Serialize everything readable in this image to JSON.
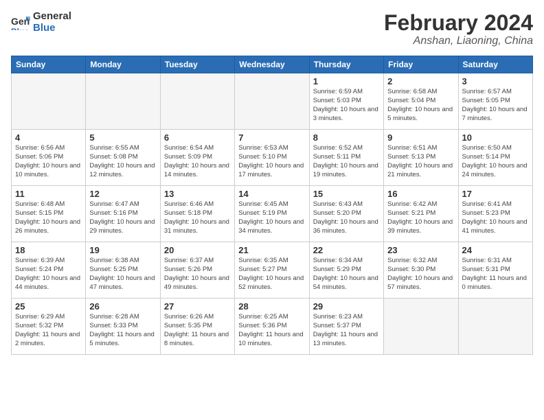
{
  "header": {
    "logo_line1": "General",
    "logo_line2": "Blue",
    "main_title": "February 2024",
    "subtitle": "Anshan, Liaoning, China"
  },
  "weekdays": [
    "Sunday",
    "Monday",
    "Tuesday",
    "Wednesday",
    "Thursday",
    "Friday",
    "Saturday"
  ],
  "weeks": [
    [
      {
        "day": "",
        "info": ""
      },
      {
        "day": "",
        "info": ""
      },
      {
        "day": "",
        "info": ""
      },
      {
        "day": "",
        "info": ""
      },
      {
        "day": "1",
        "info": "Sunrise: 6:59 AM\nSunset: 5:03 PM\nDaylight: 10 hours\nand 3 minutes."
      },
      {
        "day": "2",
        "info": "Sunrise: 6:58 AM\nSunset: 5:04 PM\nDaylight: 10 hours\nand 5 minutes."
      },
      {
        "day": "3",
        "info": "Sunrise: 6:57 AM\nSunset: 5:05 PM\nDaylight: 10 hours\nand 7 minutes."
      }
    ],
    [
      {
        "day": "4",
        "info": "Sunrise: 6:56 AM\nSunset: 5:06 PM\nDaylight: 10 hours\nand 10 minutes."
      },
      {
        "day": "5",
        "info": "Sunrise: 6:55 AM\nSunset: 5:08 PM\nDaylight: 10 hours\nand 12 minutes."
      },
      {
        "day": "6",
        "info": "Sunrise: 6:54 AM\nSunset: 5:09 PM\nDaylight: 10 hours\nand 14 minutes."
      },
      {
        "day": "7",
        "info": "Sunrise: 6:53 AM\nSunset: 5:10 PM\nDaylight: 10 hours\nand 17 minutes."
      },
      {
        "day": "8",
        "info": "Sunrise: 6:52 AM\nSunset: 5:11 PM\nDaylight: 10 hours\nand 19 minutes."
      },
      {
        "day": "9",
        "info": "Sunrise: 6:51 AM\nSunset: 5:13 PM\nDaylight: 10 hours\nand 21 minutes."
      },
      {
        "day": "10",
        "info": "Sunrise: 6:50 AM\nSunset: 5:14 PM\nDaylight: 10 hours\nand 24 minutes."
      }
    ],
    [
      {
        "day": "11",
        "info": "Sunrise: 6:48 AM\nSunset: 5:15 PM\nDaylight: 10 hours\nand 26 minutes."
      },
      {
        "day": "12",
        "info": "Sunrise: 6:47 AM\nSunset: 5:16 PM\nDaylight: 10 hours\nand 29 minutes."
      },
      {
        "day": "13",
        "info": "Sunrise: 6:46 AM\nSunset: 5:18 PM\nDaylight: 10 hours\nand 31 minutes."
      },
      {
        "day": "14",
        "info": "Sunrise: 6:45 AM\nSunset: 5:19 PM\nDaylight: 10 hours\nand 34 minutes."
      },
      {
        "day": "15",
        "info": "Sunrise: 6:43 AM\nSunset: 5:20 PM\nDaylight: 10 hours\nand 36 minutes."
      },
      {
        "day": "16",
        "info": "Sunrise: 6:42 AM\nSunset: 5:21 PM\nDaylight: 10 hours\nand 39 minutes."
      },
      {
        "day": "17",
        "info": "Sunrise: 6:41 AM\nSunset: 5:23 PM\nDaylight: 10 hours\nand 41 minutes."
      }
    ],
    [
      {
        "day": "18",
        "info": "Sunrise: 6:39 AM\nSunset: 5:24 PM\nDaylight: 10 hours\nand 44 minutes."
      },
      {
        "day": "19",
        "info": "Sunrise: 6:38 AM\nSunset: 5:25 PM\nDaylight: 10 hours\nand 47 minutes."
      },
      {
        "day": "20",
        "info": "Sunrise: 6:37 AM\nSunset: 5:26 PM\nDaylight: 10 hours\nand 49 minutes."
      },
      {
        "day": "21",
        "info": "Sunrise: 6:35 AM\nSunset: 5:27 PM\nDaylight: 10 hours\nand 52 minutes."
      },
      {
        "day": "22",
        "info": "Sunrise: 6:34 AM\nSunset: 5:29 PM\nDaylight: 10 hours\nand 54 minutes."
      },
      {
        "day": "23",
        "info": "Sunrise: 6:32 AM\nSunset: 5:30 PM\nDaylight: 10 hours\nand 57 minutes."
      },
      {
        "day": "24",
        "info": "Sunrise: 6:31 AM\nSunset: 5:31 PM\nDaylight: 11 hours\nand 0 minutes."
      }
    ],
    [
      {
        "day": "25",
        "info": "Sunrise: 6:29 AM\nSunset: 5:32 PM\nDaylight: 11 hours\nand 2 minutes."
      },
      {
        "day": "26",
        "info": "Sunrise: 6:28 AM\nSunset: 5:33 PM\nDaylight: 11 hours\nand 5 minutes."
      },
      {
        "day": "27",
        "info": "Sunrise: 6:26 AM\nSunset: 5:35 PM\nDaylight: 11 hours\nand 8 minutes."
      },
      {
        "day": "28",
        "info": "Sunrise: 6:25 AM\nSunset: 5:36 PM\nDaylight: 11 hours\nand 10 minutes."
      },
      {
        "day": "29",
        "info": "Sunrise: 6:23 AM\nSunset: 5:37 PM\nDaylight: 11 hours\nand 13 minutes."
      },
      {
        "day": "",
        "info": ""
      },
      {
        "day": "",
        "info": ""
      }
    ]
  ]
}
